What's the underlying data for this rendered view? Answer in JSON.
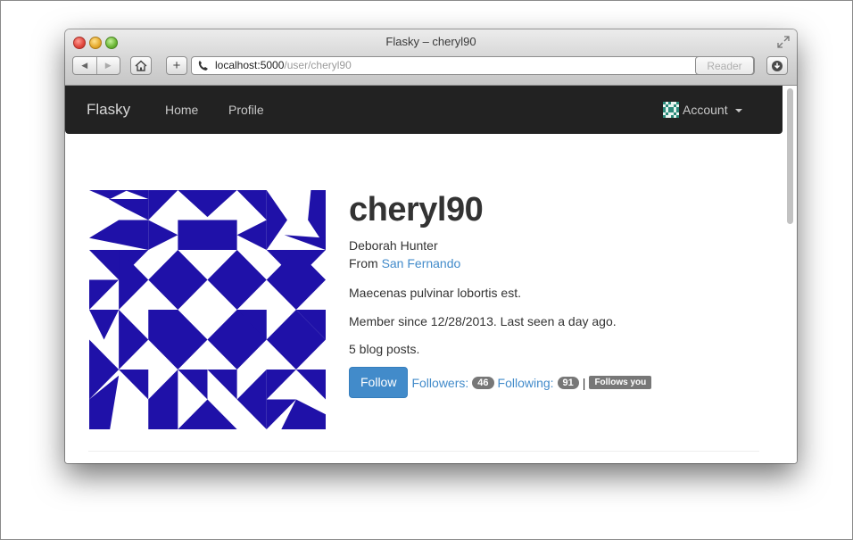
{
  "window": {
    "title": "Flasky – cheryl90"
  },
  "toolbar": {
    "back_icon": "◀",
    "forward_icon": "▶",
    "home_icon": "home-icon",
    "add_icon": "+",
    "url_host": "localhost:5000",
    "url_path": "/user/cheryl90",
    "reload_icon": "↻",
    "reader_label": "Reader",
    "download_icon": "download-icon"
  },
  "navbar": {
    "brand": "Flasky",
    "links": [
      "Home",
      "Profile"
    ],
    "account_label": "Account"
  },
  "profile": {
    "username": "cheryl90",
    "real_name": "Deborah Hunter",
    "from_prefix": "From ",
    "location": "San Fernando",
    "about": "Maecenas pulvinar lobortis est.",
    "member_since": "Member since 12/28/2013. Last seen a day ago.",
    "posts": "5 blog posts.",
    "follow_label": "Follow",
    "followers_label": "Followers:",
    "followers_count": "46",
    "following_label": "Following:",
    "following_count": "91",
    "separator": "|",
    "follows_you": "Follows you"
  },
  "colors": {
    "identicon": "#1f11a8",
    "link": "#428bca",
    "navbar_bg": "#222222",
    "badge": "#777777"
  }
}
